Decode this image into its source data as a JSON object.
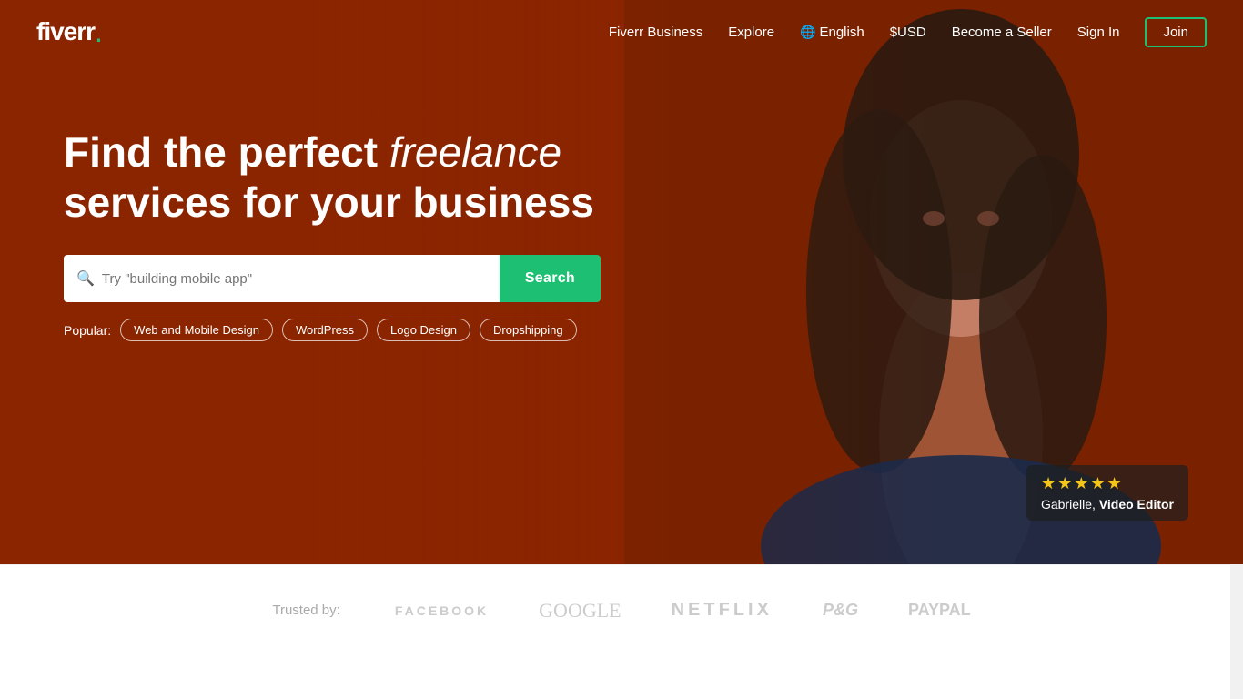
{
  "logo": {
    "text": "fiverr",
    "dot": "."
  },
  "navbar": {
    "links": [
      {
        "id": "fiverr-business",
        "label": "Fiverr Business"
      },
      {
        "id": "explore",
        "label": "Explore"
      },
      {
        "id": "language",
        "label": "English"
      },
      {
        "id": "currency",
        "label": "$USD"
      },
      {
        "id": "become-seller",
        "label": "Become a Seller"
      },
      {
        "id": "sign-in",
        "label": "Sign In"
      }
    ],
    "join_label": "Join"
  },
  "hero": {
    "title_part1": "Find the perfect ",
    "title_italic": "freelance",
    "title_part2": "services for your business",
    "search": {
      "placeholder": "Try \"building mobile app\"",
      "button_label": "Search"
    },
    "popular": {
      "label": "Popular:",
      "tags": [
        "Web and Mobile Design",
        "WordPress",
        "Logo Design",
        "Dropshipping"
      ]
    },
    "seller": {
      "stars": "★★★★★",
      "name": "Gabrielle",
      "role": "Video Editor"
    }
  },
  "trusted": {
    "label": "Trusted by:",
    "logos": [
      {
        "id": "facebook",
        "text": "FACEBOOK"
      },
      {
        "id": "google",
        "text": "Google"
      },
      {
        "id": "netflix",
        "text": "NETFLIX"
      },
      {
        "id": "pg",
        "text": "P&G"
      },
      {
        "id": "paypal",
        "text": "PayPal"
      }
    ]
  },
  "colors": {
    "hero_bg": "#8B2500",
    "green_accent": "#1dbf73",
    "join_border": "#1dbf73"
  }
}
